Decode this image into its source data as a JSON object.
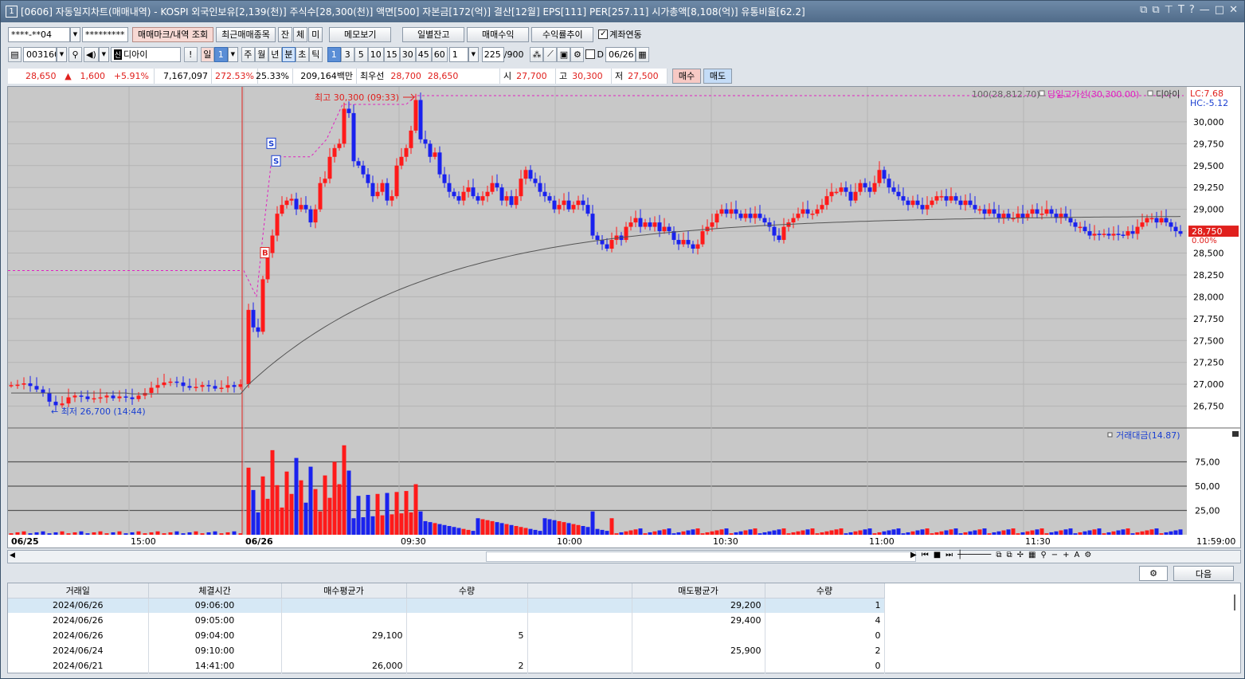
{
  "window": {
    "number": "1",
    "title": "[0606] 자동일지차트(매매내역) - KOSPI 외국인보유[2,139(천)] 주식수[28,300(천)] 액면[500] 자본금[172(억)] 결산[12월] EPS[111] PER[257.11] 시가총액[8,108(억)] 유통비율[62.2]",
    "controls": [
      "⧉",
      "⧉",
      "𝗧",
      "T",
      "?",
      "—",
      "□",
      "✕"
    ]
  },
  "toolbar1": {
    "account": "****-**04",
    "password": "*********",
    "buttons": [
      "매매마크/내역 조회",
      "최근매매종목",
      "잔",
      "체",
      "미",
      "메모보기",
      "일별잔고",
      "매매수익",
      "수익률추이"
    ],
    "checkbox_label": "계좌연동",
    "checkbox_checked": true
  },
  "toolbar2": {
    "code": "003160",
    "name": "디아이",
    "name_badge": "신",
    "period_buttons": [
      "일",
      "1",
      "주",
      "월",
      "년",
      "분",
      "초",
      "틱"
    ],
    "minute_buttons": [
      "1",
      "3",
      "5",
      "10",
      "15",
      "30",
      "45",
      "60"
    ],
    "interval": "1",
    "count": "225",
    "count_total": "/900",
    "date_checkbox_label": "D",
    "date": "06/26"
  },
  "pricebar": {
    "price": "28,650",
    "arrow": "▲",
    "change": "1,600",
    "rate": "+5.91%",
    "volume": "7,167,097",
    "vol_rate": "272.53%",
    "turnover": "25.33%",
    "amount": "209,164백만",
    "best_label": "최우선",
    "ask": "28,700",
    "bid": "28,650",
    "open_label": "시",
    "open": "27,700",
    "high_label": "고",
    "high": "30,300",
    "low_label": "저",
    "low": "27,500",
    "buy_label": "매수",
    "sell_label": "매도"
  },
  "chart_data": {
    "type": "candlestick",
    "symbol": "디아이",
    "ylim": [
      26500,
      30400
    ],
    "y_ticks": [
      "30,000",
      "29,750",
      "29,500",
      "29,250",
      "29,000",
      "28,750",
      "28,500",
      "28,250",
      "28,000",
      "27,750",
      "27,500",
      "27,250",
      "27,000",
      "26,750"
    ],
    "x_labels": [
      "06/25",
      "15:00",
      "06/26",
      "09:30",
      "10:00",
      "10:30",
      "11:00",
      "11:30",
      "11:59:00"
    ],
    "ma_legend": "100(28,812.70)",
    "high_line_legend": "당일고가선(30,300.00)",
    "symbol_legend": "디아이",
    "lc": "LC:7.68",
    "hc": "HC:-5.12",
    "current_price_tag": "28,750",
    "current_pct": "0.00%",
    "prev_high_line": 28300,
    "today_high_line": 30300,
    "high_annotation": "최고 30,300 (09:33)",
    "low_annotation": "최저 26,700 (14:44)",
    "trade_marks": [
      "B",
      "S",
      "S"
    ],
    "vol_legend": "거래대금(14.87)",
    "vol_ticks": [
      "75,00",
      "50,00",
      "25,00"
    ],
    "vol_ylim": [
      0,
      100
    ],
    "up_color": "#ff1a1a",
    "down_color": "#1a22ee"
  },
  "table": {
    "headers": [
      "거래일",
      "체결시간",
      "매수평균가",
      "수량",
      "",
      "매도평균가",
      "수량"
    ],
    "rows": [
      [
        "2024/06/26",
        "09:06:00",
        "",
        "",
        "",
        "29,200",
        "1"
      ],
      [
        "2024/06/26",
        "09:05:00",
        "",
        "",
        "",
        "29,400",
        "4"
      ],
      [
        "2024/06/26",
        "09:04:00",
        "29,100",
        "5",
        "",
        "",
        "0"
      ],
      [
        "2024/06/24",
        "09:10:00",
        "",
        "",
        "",
        "25,900",
        "2"
      ],
      [
        "2024/06/21",
        "14:41:00",
        "26,000",
        "2",
        "",
        "",
        "0"
      ]
    ],
    "next_label": "다음"
  }
}
